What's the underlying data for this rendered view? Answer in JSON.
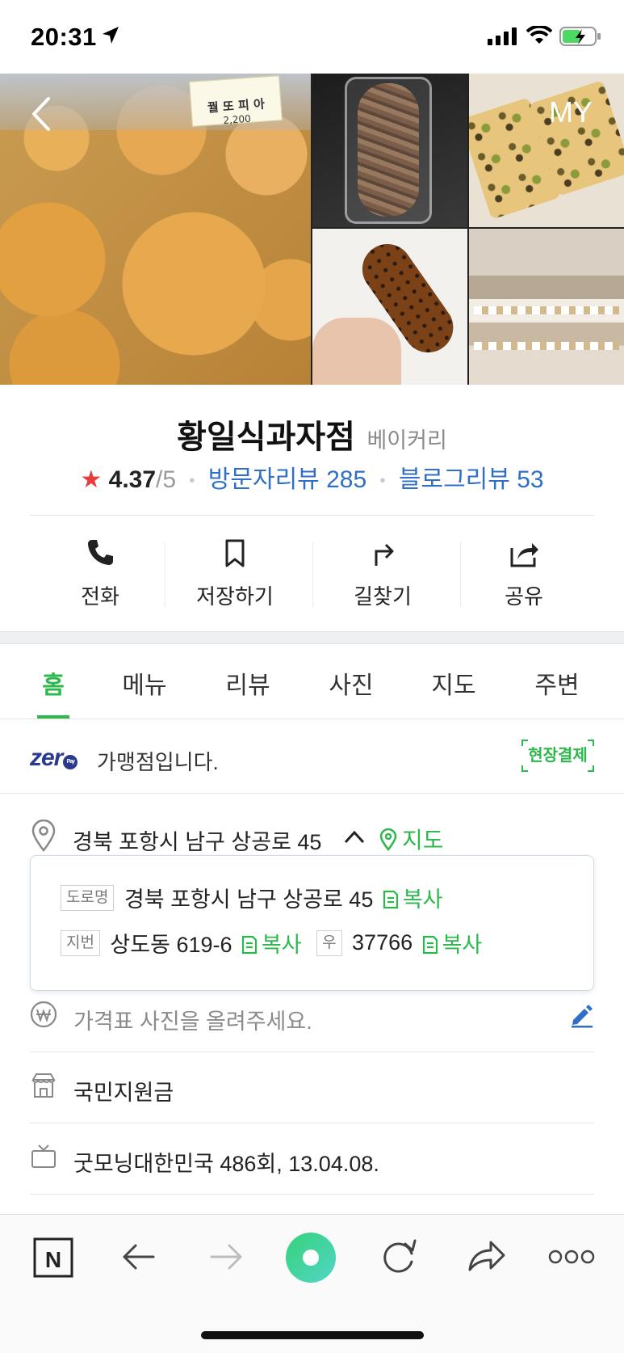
{
  "status_bar": {
    "time": "20:31"
  },
  "gallery": {
    "price_tag": "꿜 또 피 아",
    "price_small": "2,200",
    "my_label": "MY"
  },
  "place": {
    "name": "황일식과자점",
    "category": "베이커리",
    "rating": "4.37",
    "rating_max": "/5",
    "visitor_reviews": "방문자리뷰 285",
    "blog_reviews": "블로그리뷰 53"
  },
  "actions": [
    {
      "label": "전화",
      "icon": "phone-icon"
    },
    {
      "label": "저장하기",
      "icon": "bookmark-icon"
    },
    {
      "label": "길찾기",
      "icon": "directions-icon"
    },
    {
      "label": "공유",
      "icon": "share-icon"
    }
  ],
  "tabs": [
    "홈",
    "메뉴",
    "리뷰",
    "사진",
    "지도",
    "주변"
  ],
  "active_tab": "홈",
  "zeropay": {
    "logo": "zer",
    "logo_pay": "Pay",
    "text": "가맹점입니다.",
    "badge": "현장결제"
  },
  "address": {
    "main": "경북 포항시 남구 상공로 45",
    "map_link": "지도",
    "road_tag": "도로명",
    "road_value": "경북 포항시 남구 상공로 45",
    "lot_tag": "지번",
    "lot_value": "상도동 619-6",
    "zip_tag": "우",
    "zip_value": "37766",
    "copy_label": "복사"
  },
  "info_rows": {
    "price_placeholder": "가격표 사진을 올려주세요.",
    "support": "국민지원금",
    "tv": "굿모닝대한민국 486회, 13.04.08."
  },
  "bottom_bar": {
    "n_label": "N"
  },
  "colors": {
    "green": "#2db84d",
    "blue_link": "#2f6fc8",
    "star": "#e83b3b",
    "zeropay": "#2a3a8f"
  }
}
